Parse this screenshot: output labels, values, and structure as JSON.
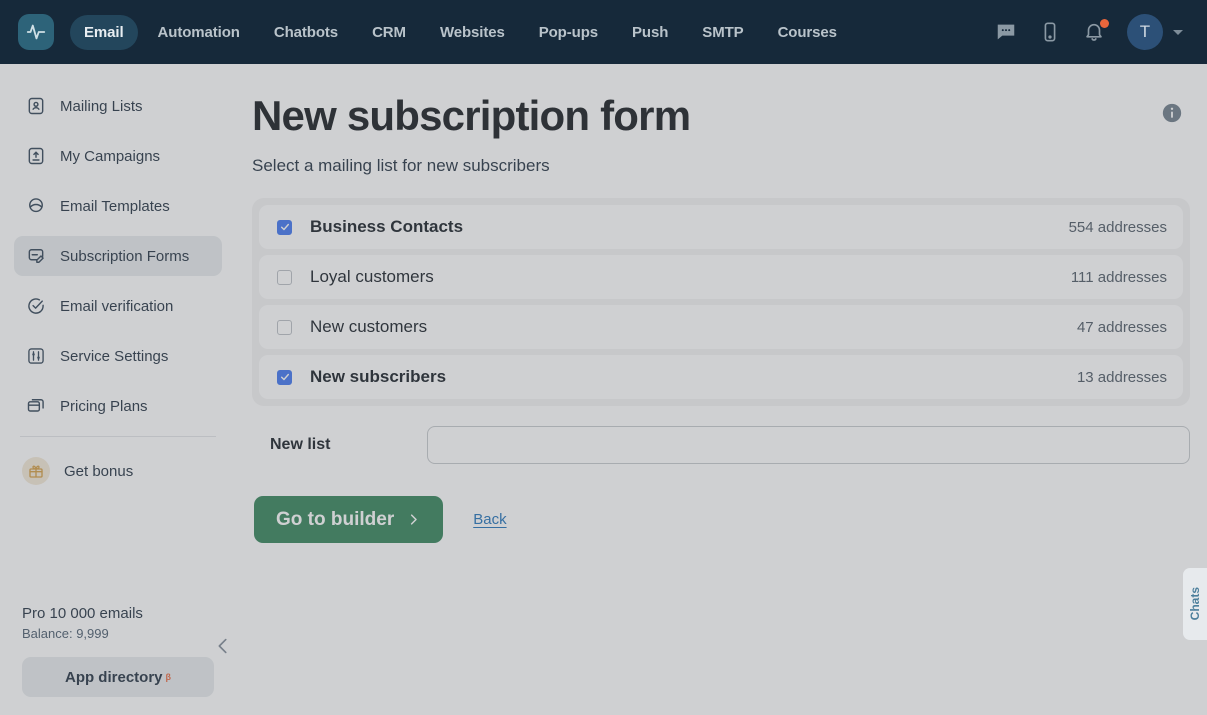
{
  "colors": {
    "nav_bg": "#16293a",
    "nav_active": "#23465c",
    "logo_bg": "#2d6379",
    "accent_green": "#2f8055",
    "checkbox_blue": "#3b72f0",
    "link_blue": "#1c6fb8",
    "badge_orange": "#e8663c",
    "beta_orange": "#e8663c",
    "sidebar_active": "#e7eaed",
    "scrim": "rgba(108,113,118,0.33)"
  },
  "topnav": {
    "logo_icon": "activity-pulse-icon",
    "links": [
      {
        "label": "Email",
        "active": true
      },
      {
        "label": "Automation",
        "active": false
      },
      {
        "label": "Chatbots",
        "active": false
      },
      {
        "label": "CRM",
        "active": false
      },
      {
        "label": "Websites",
        "active": false
      },
      {
        "label": "Pop-ups",
        "active": false
      },
      {
        "label": "Push",
        "active": false
      },
      {
        "label": "SMTP",
        "active": false
      },
      {
        "label": "Courses",
        "active": false
      }
    ],
    "icons": [
      {
        "name": "chat-bubble-icon"
      },
      {
        "name": "mobile-device-icon"
      },
      {
        "name": "notification-bell-icon",
        "has_badge": true
      }
    ],
    "avatar_initial": "T"
  },
  "sidebar": {
    "items": [
      {
        "label": "Mailing Lists",
        "icon": "contact-card-icon",
        "active": false
      },
      {
        "label": "My Campaigns",
        "icon": "upload-box-icon",
        "active": false
      },
      {
        "label": "Email Templates",
        "icon": "template-icon",
        "active": false
      },
      {
        "label": "Subscription Forms",
        "icon": "form-edit-icon",
        "active": true
      },
      {
        "label": "Email verification",
        "icon": "check-circle-icon",
        "active": false
      },
      {
        "label": "Service Settings",
        "icon": "sliders-icon",
        "active": false
      },
      {
        "label": "Pricing Plans",
        "icon": "card-stack-icon",
        "active": false
      }
    ],
    "bonus": {
      "label": "Get bonus",
      "icon": "gift-icon"
    },
    "plan_name": "Pro 10 000 emails",
    "balance": "Balance: 9,999",
    "app_directory": {
      "label": "App directory",
      "badge": "β"
    },
    "collapse_icon": "chevron-left-icon"
  },
  "main": {
    "title": "New subscription form",
    "subtitle": "Select a mailing list for new subscribers",
    "info_icon": "info-circle-icon",
    "mailing_lists": [
      {
        "name": "Business Contacts",
        "count": "554 addresses",
        "checked": true
      },
      {
        "name": "Loyal customers",
        "count": "111 addresses",
        "checked": false
      },
      {
        "name": "New customers",
        "count": "47 addresses",
        "checked": false
      },
      {
        "name": "New subscribers",
        "count": "13 addresses",
        "checked": true
      }
    ],
    "new_list": {
      "label": "New list",
      "value": "",
      "placeholder": ""
    },
    "primary_button": {
      "label": "Go to builder",
      "icon": "chevron-right-icon"
    },
    "back_link": "Back"
  },
  "chats_tab": {
    "label": "Chats"
  }
}
